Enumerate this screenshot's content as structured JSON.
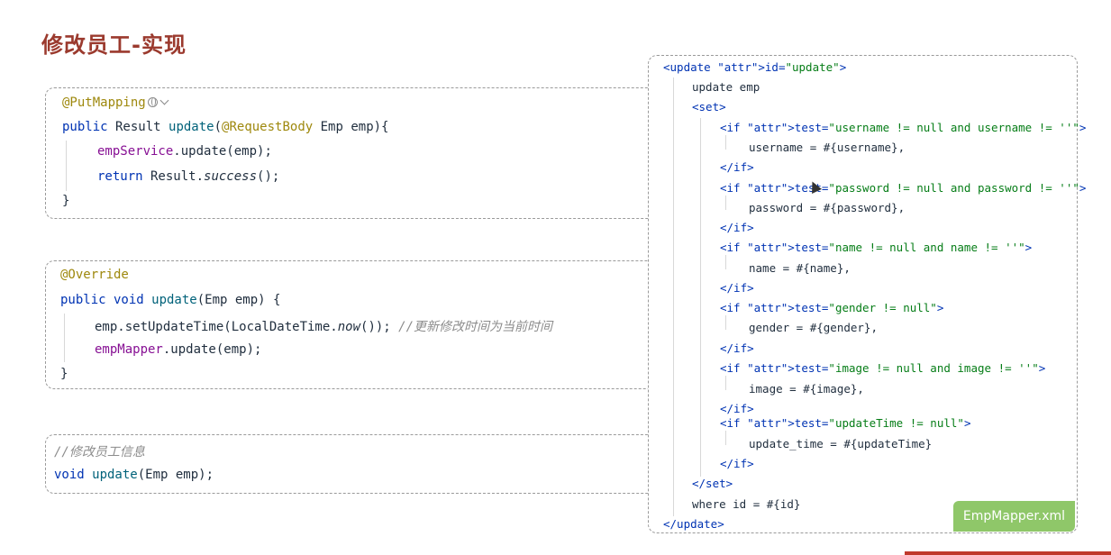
{
  "page_title": "修改员工-实现",
  "controller": {
    "annotation": "@PutMapping",
    "sig_public": "public",
    "sig_type": " Result ",
    "sig_method": "update",
    "sig_param_ann": "@RequestBody",
    "sig_param": " Emp emp){",
    "body1_field": "empService",
    "body1_rest": ".update(emp);",
    "body2_kw": "return",
    "body2_mid": " Result.",
    "body2_it": "success",
    "body2_end": "();",
    "close": "}"
  },
  "service_impl": {
    "annotation": "@Override",
    "sig_kw": "public void",
    "sig_method": " update",
    "sig_rest": "(Emp emp) {",
    "line1_code": "emp.setUpdateTime(LocalDateTime.",
    "line1_it": "now",
    "line1_end": "()); ",
    "line1_comment": "//更新修改时间为当前时间",
    "line2_field": "empMapper",
    "line2_rest": ".update(emp);",
    "close": "}"
  },
  "mapper_iface": {
    "comment": "//修改员工信息",
    "kw": "void",
    "method": " update",
    "rest": "(Emp emp);"
  },
  "xml": {
    "update_open": "<update id=\"update\">",
    "update_emp": "update emp",
    "set_open": "<set>",
    "if_username": "<if test=\"username != null and username != ''\">",
    "set_username": "username = #{username},",
    "if_close": "</if>",
    "if_password": "<if test=\"password != null and password != ''\">",
    "set_password": "password = #{password},",
    "if_name": "<if test=\"name != null and name != ''\">",
    "set_name": "name = #{name},",
    "if_gender": "<if test=\"gender != null\">",
    "set_gender": "gender = #{gender},",
    "if_image": "<if test=\"image != null and image != ''\">",
    "set_image": "image = #{image},",
    "if_updatetime": "<if test=\"updateTime != null\">",
    "set_updatetime": "update_time = #{updateTime}",
    "set_close": "</set>",
    "where": "where id = #{id}",
    "update_close": "</update>"
  },
  "file_badge": "EmpMapper.xml",
  "icons": [
    "globe-icon",
    "chevron-down-icon",
    "mouse-cursor-icon"
  ]
}
